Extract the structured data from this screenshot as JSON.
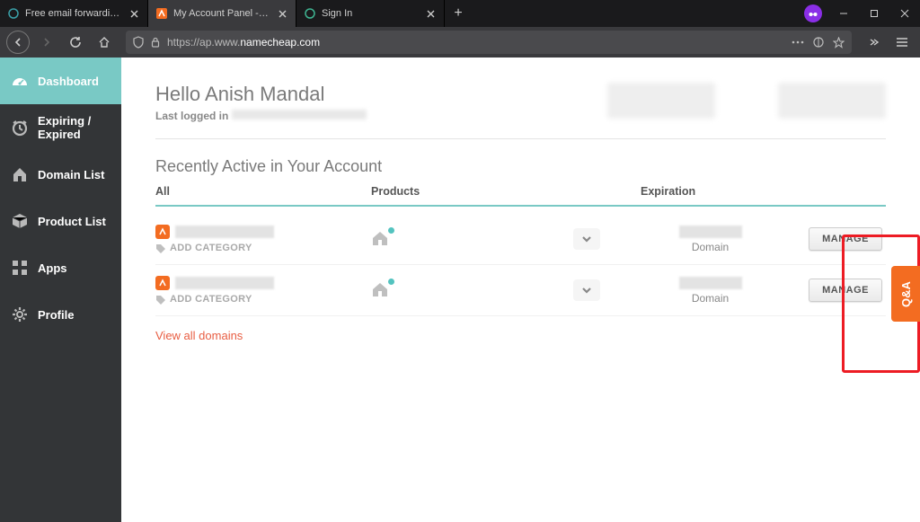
{
  "browser": {
    "tabs": [
      {
        "title": "Free email forwarding with Na",
        "active": false
      },
      {
        "title": "My Account Panel - Namecheap",
        "active": true
      },
      {
        "title": "Sign In",
        "active": false
      }
    ],
    "url_prefix": "https://ap.www.",
    "url_highlight": "namecheap.com"
  },
  "sidebar": {
    "items": [
      {
        "label": "Dashboard",
        "icon": "gauge-icon",
        "active": true
      },
      {
        "label": "Expiring / Expired",
        "icon": "clock-icon",
        "active": false
      },
      {
        "label": "Domain List",
        "icon": "house-icon",
        "active": false
      },
      {
        "label": "Product List",
        "icon": "box-icon",
        "active": false
      },
      {
        "label": "Apps",
        "icon": "grid-icon",
        "active": false
      },
      {
        "label": "Profile",
        "icon": "gear-icon",
        "active": false
      }
    ]
  },
  "header": {
    "hello": "Hello Anish Mandal",
    "last_logged_label": "Last logged in"
  },
  "section": {
    "title": "Recently Active in Your Account",
    "columns": {
      "all": "All",
      "products": "Products",
      "expiration": "Expiration"
    },
    "add_category": "ADD CATEGORY",
    "domain_label": "Domain",
    "manage": "MANAGE",
    "view_all": "View all domains"
  },
  "qa": {
    "label": "Q&A"
  }
}
